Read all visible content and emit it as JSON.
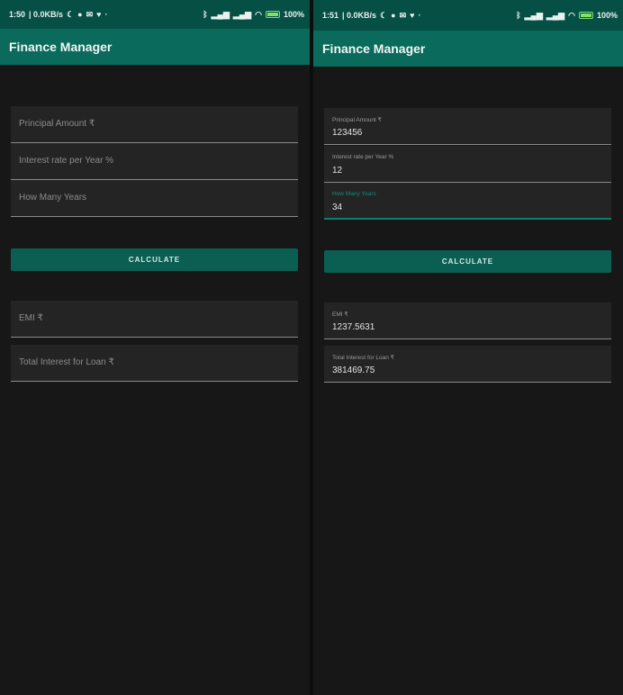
{
  "left": {
    "status": {
      "time": "1:50",
      "speed": "| 0.0KB/s",
      "battery": "100%"
    },
    "app_title": "Finance Manager",
    "inputs": [
      {
        "placeholder": "Principal Amount ₹"
      },
      {
        "placeholder": "Interest rate per Year %"
      },
      {
        "placeholder": "How Many Years"
      }
    ],
    "calculate_label": "CALCULATE",
    "outputs": [
      {
        "placeholder": "EMI ₹"
      },
      {
        "placeholder": "Total Interest for Loan ₹"
      }
    ]
  },
  "right": {
    "status": {
      "time": "1:51",
      "speed": "| 0.0KB/s",
      "battery": "100%"
    },
    "app_title": "Finance Manager",
    "inputs": [
      {
        "label": "Principal Amount ₹",
        "value": "123456"
      },
      {
        "label": "Interest rate per Year %",
        "value": "12"
      },
      {
        "label": "How Many Years",
        "value": "34"
      }
    ],
    "calculate_label": "CALCULATE",
    "outputs": [
      {
        "label": "EMI ₹",
        "value": "1237.5631"
      },
      {
        "label": "Total Interest for Loan ₹",
        "value": "381469.75"
      }
    ]
  },
  "colors": {
    "status_bar": "#064f45",
    "app_bar": "#0a6b5c",
    "button": "#0b5f52",
    "background": "#171717",
    "field": "#242424",
    "accent": "#138c76"
  }
}
